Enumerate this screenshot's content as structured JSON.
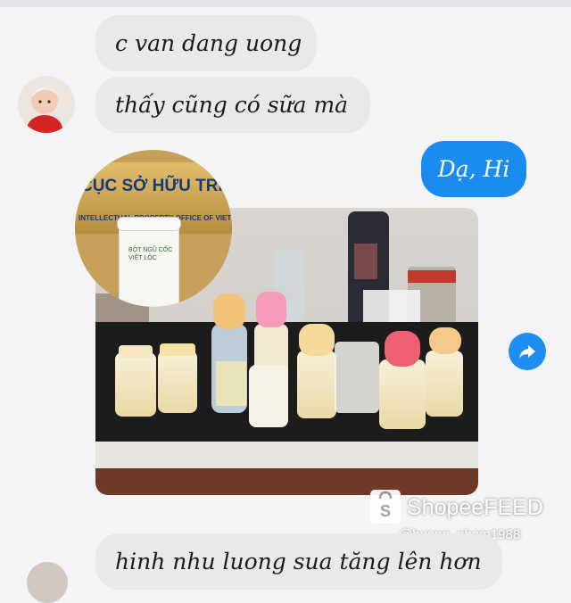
{
  "messages": {
    "in_1": "c van dang uong",
    "in_2": "thấy cũng có sữa mà",
    "out_1": "Dạ, Hi",
    "in_3": "hinh nhu luong sua tăng lên hơn"
  },
  "inset": {
    "plaque_line1": "CỤC SỞ HỮU TRÍ TUỆ",
    "plaque_line2": "INTELLECTUAL PROPERTY OFFICE OF VIET NAM",
    "can_label": "BỘT NGŨ CỐC VIỆT LỘC"
  },
  "watermark": {
    "brand": "ShopeeFEED",
    "handle": "@huong_pham1988"
  },
  "colors": {
    "incoming_bubble": "#e9e9ec",
    "outgoing_bubble": "#1a8cf0",
    "share_button": "#1f8ef1"
  }
}
